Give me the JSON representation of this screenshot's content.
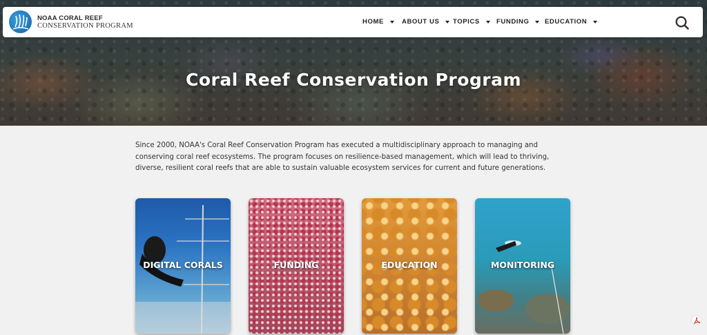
{
  "header": {
    "logo_line1": "NOAA CORAL REEF",
    "logo_line2": "CONSERVATION PROGRAM",
    "nav": [
      {
        "label": "HOME"
      },
      {
        "label": "ABOUT US"
      },
      {
        "label": "TOPICS"
      },
      {
        "label": "FUNDING"
      },
      {
        "label": "EDUCATION"
      }
    ],
    "search_icon": "search-icon"
  },
  "hero": {
    "title": "Coral Reef Conservation Program"
  },
  "intro": {
    "text": "Since 2000, NOAA's Coral Reef Conservation Program has executed a multidisciplinary approach to managing and conserving coral reef ecosystems. The program focuses on resilience-based management, which will lead to thriving, diverse, resilient coral reefs that are able to sustain valuable ecosystem services for current and future generations."
  },
  "cards": [
    {
      "label": "DIGITAL CORALS"
    },
    {
      "label": "FUNDING"
    },
    {
      "label": "EDUCATION"
    },
    {
      "label": "MONITORING"
    }
  ],
  "colors": {
    "page_bg": "#f1f1f1",
    "nav_text": "#222222",
    "logo_blue": "#1a73b9"
  },
  "icons": [
    "noaa-logo-icon",
    "chevron-down-icon",
    "search-icon",
    "pdf-icon"
  ]
}
